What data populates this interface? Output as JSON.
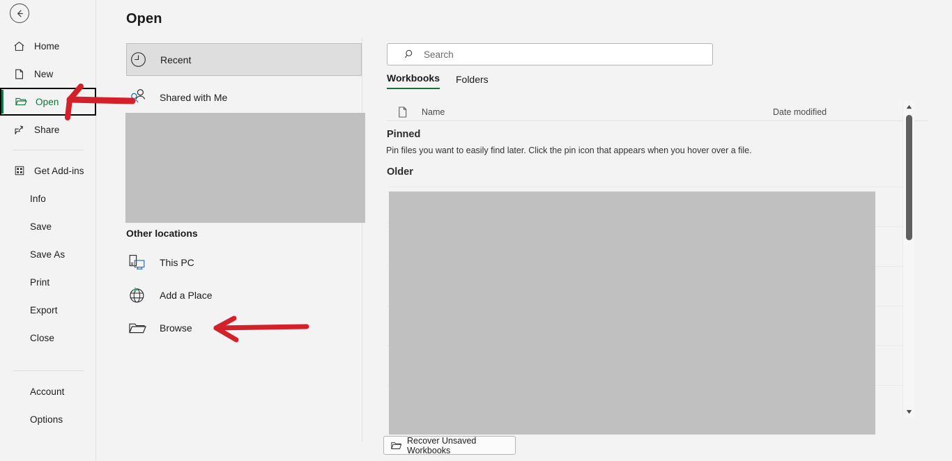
{
  "app": {
    "page_title": "Open",
    "accent_green": "#14703c",
    "annotation_red": "#d32029",
    "redaction_gray": "#c0c0c0"
  },
  "sidebar": {
    "back_button": "back-arrow-icon",
    "items": [
      {
        "label": "Home",
        "icon": "home-icon",
        "selected": false
      },
      {
        "label": "New",
        "icon": "new-file-icon",
        "selected": false
      },
      {
        "label": "Open",
        "icon": "open-folder-icon",
        "selected": true
      },
      {
        "label": "Share",
        "icon": "share-icon",
        "selected": false
      },
      {
        "label": "Get Add-ins",
        "icon": "addins-grid-icon",
        "selected": false
      },
      {
        "label": "Info",
        "icon": "",
        "selected": false
      },
      {
        "label": "Save",
        "icon": "",
        "selected": false
      },
      {
        "label": "Save As",
        "icon": "",
        "selected": false
      },
      {
        "label": "Print",
        "icon": "",
        "selected": false
      },
      {
        "label": "Export",
        "icon": "",
        "selected": false
      },
      {
        "label": "Close",
        "icon": "",
        "selected": false
      },
      {
        "label": "Account",
        "icon": "",
        "selected": false
      },
      {
        "label": "Options",
        "icon": "",
        "selected": false
      }
    ]
  },
  "places": {
    "top": [
      {
        "label": "Recent",
        "icon": "clock-icon",
        "selected": true
      },
      {
        "label": "Shared with Me",
        "icon": "people-icon",
        "selected": false
      }
    ],
    "other_locations_heading": "Other locations",
    "other": [
      {
        "label": "This PC",
        "icon": "this-pc-icon"
      },
      {
        "label": "Add a Place",
        "icon": "globe-plus-icon"
      },
      {
        "label": "Browse",
        "icon": "folder-icon"
      }
    ]
  },
  "file_list": {
    "search": {
      "placeholder": "Search",
      "value": "",
      "icon": "search-icon"
    },
    "tabs": [
      {
        "label": "Workbooks",
        "active": true
      },
      {
        "label": "Folders",
        "active": false
      }
    ],
    "columns": {
      "name": "Name",
      "date_modified": "Date modified",
      "name_icon": "document-icon"
    },
    "sections": [
      {
        "heading": "Pinned",
        "description": "Pin files you want to easily find later. Click the pin icon that appears when you hover over a file."
      },
      {
        "heading": "Older",
        "description": ""
      }
    ],
    "recover_button": {
      "label": "Recover Unsaved Workbooks",
      "icon": "open-folder-icon"
    },
    "scrollbar": {
      "up_icon": "scroll-up-arrow-icon",
      "down_icon": "scroll-down-arrow-icon"
    }
  },
  "annotations": [
    {
      "name": "arrow-pointing-to-open",
      "target": "Open"
    },
    {
      "name": "arrow-pointing-to-browse",
      "target": "Browse"
    }
  ]
}
